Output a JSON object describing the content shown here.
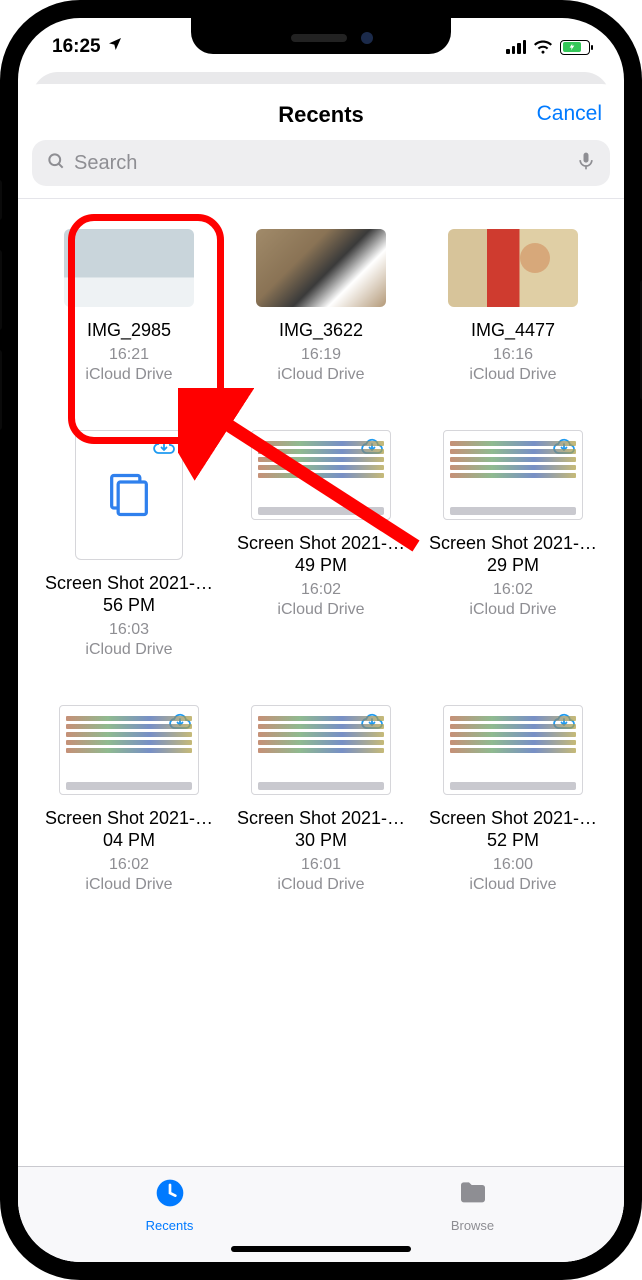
{
  "status": {
    "time": "16:25"
  },
  "sheet": {
    "title": "Recents",
    "cancel_label": "Cancel",
    "search_placeholder": "Search"
  },
  "files": [
    {
      "name": "IMG_2985",
      "time": "16:21",
      "location": "iCloud Drive",
      "kind": "landscape",
      "cloud": false
    },
    {
      "name": "IMG_3622",
      "time": "16:19",
      "location": "iCloud Drive",
      "kind": "dog",
      "cloud": false
    },
    {
      "name": "IMG_4477",
      "time": "16:16",
      "location": "iCloud Drive",
      "kind": "person",
      "cloud": false
    },
    {
      "name": "Screen Shot 2021-…56 PM",
      "time": "16:03",
      "location": "iCloud Drive",
      "kind": "doc",
      "cloud": true
    },
    {
      "name": "Screen Shot 2021-…49 PM",
      "time": "16:02",
      "location": "iCloud Drive",
      "kind": "shot",
      "cloud": true
    },
    {
      "name": "Screen Shot 2021-…29 PM",
      "time": "16:02",
      "location": "iCloud Drive",
      "kind": "shot",
      "cloud": true
    },
    {
      "name": "Screen Shot 2021-…04 PM",
      "time": "16:02",
      "location": "iCloud Drive",
      "kind": "shot",
      "cloud": true
    },
    {
      "name": "Screen Shot 2021-…30 PM",
      "time": "16:01",
      "location": "iCloud Drive",
      "kind": "shot",
      "cloud": true
    },
    {
      "name": "Screen Shot 2021-…52 PM",
      "time": "16:00",
      "location": "iCloud Drive",
      "kind": "shot",
      "cloud": true
    }
  ],
  "tabbar": {
    "recents_label": "Recents",
    "browse_label": "Browse"
  }
}
